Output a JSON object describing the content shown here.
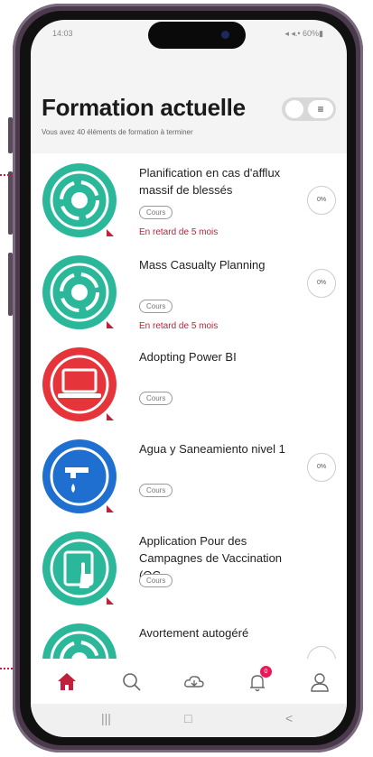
{
  "colors": {
    "accent": "#c0203a",
    "teal": "#2bb89a",
    "red": "#e5343a",
    "blue": "#1f6fd1",
    "home": "#c0203a"
  },
  "status_bar": {
    "time": "14:03",
    "icons": "◂ ◂.• 60%▮"
  },
  "header": {
    "title": "Formation actuelle",
    "subtitle": "Vous avez 40 éléments de formation à terminer",
    "view_toggle_icon": "list-icon"
  },
  "courses": [
    {
      "title": "Planification en cas d'afflux massif de blessés",
      "badge": "Cours",
      "status": "En retard de 5 mois",
      "progress": "0%",
      "icon": "medical-cycle-icon"
    },
    {
      "title": "Mass Casualty Planning",
      "badge": "Cours",
      "status": "En retard de 5 mois",
      "progress": "0%",
      "icon": "medical-cycle-icon"
    },
    {
      "title": "Adopting Power BI",
      "badge": "Cours",
      "status": "",
      "progress": "",
      "icon": "laptop-icon"
    },
    {
      "title": "Agua y Saneamiento nivel 1",
      "badge": "Cours",
      "status": "",
      "progress": "0%",
      "icon": "water-tap-icon"
    },
    {
      "title": "Application Pour des Campagnes de Vaccination (OC…",
      "badge": "Cours",
      "status": "",
      "progress": "",
      "icon": "tablet-touch-icon"
    },
    {
      "title": "Avortement autogéré",
      "badge": "",
      "status": "",
      "progress": "",
      "icon": "medical-cycle-icon"
    }
  ],
  "tabbar": {
    "items": [
      "home-icon",
      "search-icon",
      "download-cloud-icon",
      "notification-bell-icon",
      "profile-icon"
    ],
    "notification_count": "0"
  },
  "system_nav": {
    "recents": "|||",
    "home": "□",
    "back": "<"
  }
}
